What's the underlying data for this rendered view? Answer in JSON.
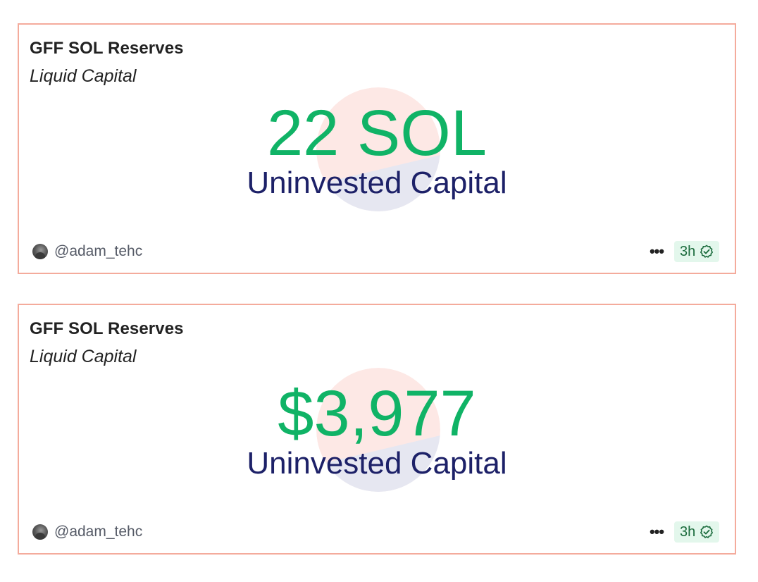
{
  "cards": [
    {
      "title": "GFF SOL Reserves",
      "subtitle": "Liquid Capital",
      "value": "22 SOL",
      "caption": "Uninvested Capital",
      "author": "@adam_tehc",
      "more_label": "•••",
      "time": "3h",
      "status_icon": "verified-check-icon"
    },
    {
      "title": "GFF SOL Reserves",
      "subtitle": "Liquid Capital",
      "value": "$3,977",
      "caption": "Uninvested Capital",
      "author": "@adam_tehc",
      "more_label": "•••",
      "time": "3h",
      "status_icon": "verified-check-icon"
    }
  ],
  "colors": {
    "card_border": "#f4ab9c",
    "value_green": "#10b366",
    "caption_navy": "#1d2168",
    "pie_top": "#fde8e5",
    "pie_bottom": "#e6e7f1",
    "badge_bg": "#e3f7ec",
    "badge_text": "#1a6b3c"
  }
}
